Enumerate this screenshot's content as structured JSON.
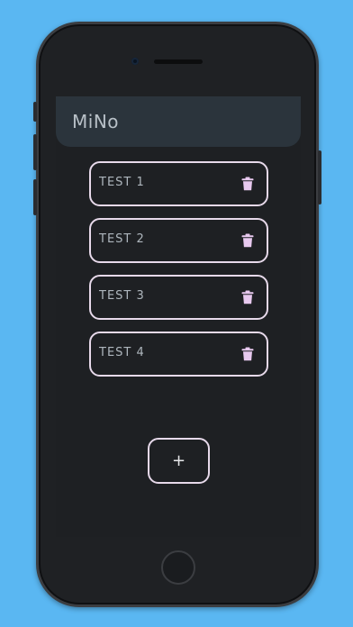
{
  "app": {
    "title": "MiNo"
  },
  "notes": [
    {
      "label": "TEST 1",
      "delete_icon": "trash-icon"
    },
    {
      "label": "TEST 2",
      "delete_icon": "trash-icon"
    },
    {
      "label": "TEST 3",
      "delete_icon": "trash-icon"
    },
    {
      "label": "TEST 4",
      "delete_icon": "trash-icon"
    }
  ],
  "add_button": {
    "label": "+"
  },
  "colors": {
    "background": "#5ab7f2",
    "screen": "#1e2023",
    "appbar": "#2b343c",
    "accent_border": "#e7d9ea",
    "icon": "#e8c9ef"
  }
}
